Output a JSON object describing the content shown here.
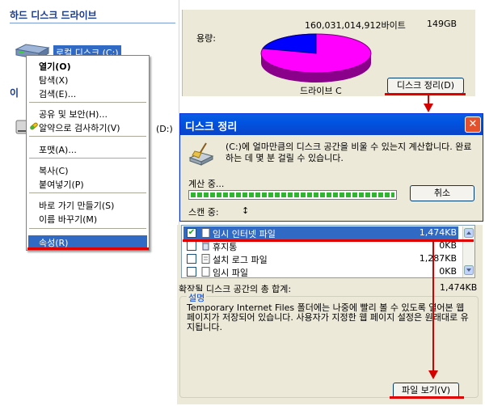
{
  "explorer": {
    "section_title": "하드 디스크 드라이브",
    "drive_c_label": "로컬 디스크 (C:)",
    "partial_header": "이",
    "partial_d": "(D:)"
  },
  "context_menu": {
    "items": [
      {
        "label": "열기(O)"
      },
      {
        "label": "탐색(X)"
      },
      {
        "label": "검색(E)..."
      },
      {
        "label": "공유 및 보안(H)..."
      },
      {
        "label": "알약으로 검사하기(V)"
      },
      {
        "label": "포맷(A)..."
      },
      {
        "label": "복사(C)"
      },
      {
        "label": "붙여넣기(P)"
      },
      {
        "label": "바로 가기 만들기(S)"
      },
      {
        "label": "이름 바꾸기(M)"
      },
      {
        "label": "속성(R)"
      }
    ]
  },
  "properties": {
    "capacity_label": "용량:",
    "bytes_value": "160,031,014,912바이트",
    "gb_value": "149GB",
    "drive_label": "드라이브 C",
    "cleanup_button": "디스크 정리(D)",
    "colors": {
      "used": "#0000ff",
      "free": "#ff00ff"
    }
  },
  "dialog": {
    "title": "디스크 정리",
    "close_glyph": "✕",
    "message": "(C:)에 얼마만큼의 디스크 공간을 비울 수 있는지 계산합니다. 완료하는 데 몇 분 걸릴 수 있습니다.",
    "calc_label": "계산 중...",
    "cancel_button": "취소",
    "scan_label": "스캔 중:",
    "scan_value": "↕"
  },
  "files": {
    "rows": [
      {
        "name": "임시 인터넷 파일",
        "size": "1,474KB",
        "checked": true
      },
      {
        "name": "휴지통",
        "size": "0KB",
        "checked": false
      },
      {
        "name": "설치 로그 파일",
        "size": "1,287KB",
        "checked": false
      },
      {
        "name": "임시 파일",
        "size": "0KB",
        "checked": false
      }
    ],
    "total_label": "확장될 디스크 공간의 총 합계:",
    "total_value": "1,474KB",
    "desc_legend": "설명",
    "desc_text": "Temporary Internet Files 폴더에는 나중에 빨리 볼 수 있도록 열어본 웹 페이지가 저장되어 있습니다. 사용자가 지정한 웹 페이지 설정은 원래대로 유지됩니다.",
    "view_button": "파일 보기(V)"
  },
  "accent": {
    "highlight": "#316ac5",
    "annotation_red": "#e00000"
  }
}
